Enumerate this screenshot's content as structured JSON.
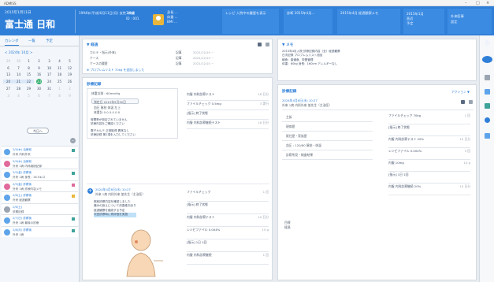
{
  "window": {
    "title": "ADMISS",
    "controls": [
      "–",
      "□",
      "×"
    ]
  },
  "header": {
    "date": "2015年1月11日",
    "title": "富士通 日和",
    "patient_info": "1994年(平成)6月11日(月)  女性  29歳",
    "room": "1病棟",
    "bed": "ID : 001",
    "p1_lines": [
      "身長 ...",
      "体重 ...",
      "BMI ..."
    ],
    "p2_text": "レシピ 入院中の履歴を表示",
    "p3_text": "診断 2015年4月...",
    "p4_text": "2015年4月 経過観察メモ",
    "p5_lines": [
      "2015年1月",
      "直近",
      "予定"
    ],
    "p6_lines": [
      "外来医事",
      "設定"
    ]
  },
  "left": {
    "tabs": [
      "カレンダ",
      "一覧",
      "予定"
    ],
    "calendar_title": "< 2024年 10月 >",
    "weeks": [
      [
        "29",
        "30",
        "1",
        "2",
        "3",
        "4",
        "5"
      ],
      [
        "6",
        "7",
        "8",
        "9",
        "10",
        "11",
        "12"
      ],
      [
        "13",
        "14",
        "15",
        "16",
        "17",
        "18",
        "19"
      ],
      [
        "20",
        "21",
        "22",
        "23",
        "24",
        "25",
        "26"
      ],
      [
        "27",
        "28",
        "29",
        "30",
        "31",
        "1",
        "2"
      ],
      [
        "3",
        "4",
        "5",
        "6",
        "7",
        "8",
        "9"
      ]
    ],
    "today_label": "今日へ",
    "history": [
      {
        "l1": "2/4(木) 治療前",
        "l2": "外来  内科外来"
      },
      {
        "l1": "2/4(木) 治療前",
        "l2": "外来  1病  内科継続記録"
      },
      {
        "l1": "2/5(金) 診察後",
        "l2": "外来  1病  身長 : 16.5キロ"
      },
      {
        "l1": "2/5(金) 診察後",
        "l2": "外来  1病  診療内容メモ"
      },
      {
        "l1": "2/6(土) 診察後",
        "l2": "外来  経過観察"
      },
      {
        "l1": "2/6(土)",
        "l2": "診察記録"
      },
      {
        "l1": "2/7(日) 診察後",
        "l2": "外来  1病  最後の診療"
      },
      {
        "l1": "2/8(月) 診察後",
        "l2": "外来  1病"
      }
    ]
  },
  "main": {
    "top_card": {
      "title": "▼ 経過",
      "rows": [
        {
          "k": "カルテ・指示(外来)",
          "d": "記事",
          "v": "2021/12/10 ~"
        },
        {
          "k": "ケース",
          "d": "記事",
          "v": "2021/12/10 ~"
        },
        {
          "k": "ケースの履歴",
          "d": "記事",
          "v": "2021/12/10 ~"
        }
      ],
      "footer": "⊕ プロブレムリスト 70kg を追加しました"
    },
    "records_title": "診療記録",
    "vitals": {
      "label": "体重計測 : 60mmHg",
      "date": "測定日 2015年5月30日",
      "h1": "血圧  脉拍  体温  左上",
      "h2": "体重計  0.0  0.0  0.0"
    },
    "notes": [
      "時間帯が設定されていません",
      "診療内容をご確認ください",
      "電子カルテ 正常取得 異常なし",
      "診療記録 第1項を入力してください"
    ],
    "orders1": [
      {
        "t": "内服  内科診察テスト",
        "s": "18 日分"
      },
      {
        "t": "ファイルチェック 0.5mg",
        "s": "3 実行"
      },
      {
        "t": "[指示]  終了状態",
        "s": ""
      },
      {
        "t": "内服  内科診察継続テスト",
        "s": "18 日分"
      }
    ],
    "record2": {
      "title": "2024年4月6日(水) 10:27",
      "sub": "外来  1病  内科外来  某先生（主治医）",
      "lines": [
        "照射診察内容を確認しました",
        "痛みの訴えについて改善倠向あり",
        "経過観察を継続する予定"
      ],
      "hl": "次回診察時に再評価を実施"
    },
    "orders2": [
      {
        "t": "ファイルチェック",
        "s": "1 回"
      },
      {
        "t": "[指示]  終了状態",
        "s": ""
      },
      {
        "t": "内服  内科診察テスト",
        "s": "10 日分"
      },
      {
        "t": "レシピファイル 0.004%",
        "s": "10 g"
      },
      {
        "t": "[指示]  1日 1回",
        "s": ""
      },
      {
        "t": "内服  内科診察継続",
        "s": "1 回"
      }
    ]
  },
  "right": {
    "memo": {
      "title": "▼ メモ",
      "lines": [
        "2015年4月入院 診療記録内容（全）経過観察",
        "日次記録 プロブレムリスト追加",
        "朝食：普通食、栄養管理",
        "体重：60kg  身長：160cm  アレルギーなし"
      ]
    },
    "care": {
      "title": "診療記録",
      "badge": "アクション ▼",
      "head": "2024年4月6日(水) 10:27",
      "sub": "外来  1病  内科外来  某先生（主治医）",
      "left_rows": [
        "主訴",
        "現病歴",
        "既往歴・家族歴",
        "血圧 : 120/80  脉拍・体温",
        "診察所見・検査結果"
      ],
      "orders": [
        {
          "t": "ファイルチェック 70kg",
          "s": "1 回"
        },
        {
          "t": "[指示]  終了状態",
          "s": ""
        },
        {
          "t": "内服  内科診察テスト 20%",
          "s": "10 日分"
        },
        {
          "t": "レシピファイル 0.004%",
          "s": "3 回"
        },
        {
          "t": "内服 10mg",
          "s": "10 g"
        },
        {
          "t": "[指示]  1日 1回",
          "s": ""
        },
        {
          "t": "内服  内科診察継続 20%",
          "s": "10 日分"
        }
      ],
      "foot": [
        "目標",
        "経過"
      ]
    }
  },
  "sidebar": {
    "icons": [
      "blue-ring",
      "list",
      "calendar",
      "chart",
      "person",
      "chat"
    ]
  }
}
